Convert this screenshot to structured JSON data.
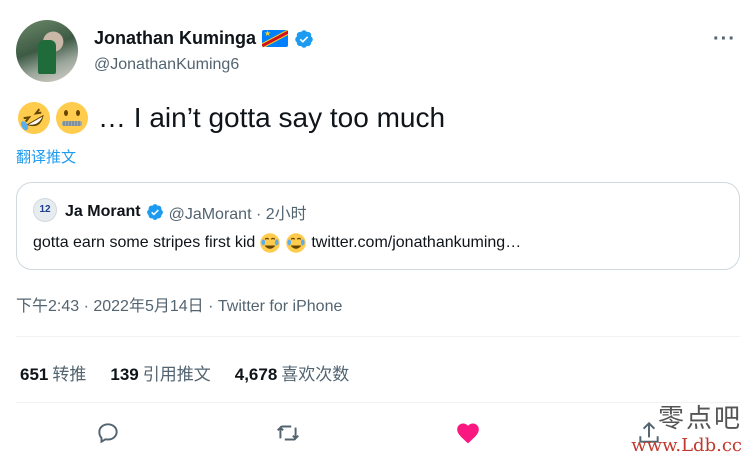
{
  "author": {
    "display_name": "Jonathan Kuminga",
    "handle": "@JonathanKuming6"
  },
  "more_label": "···",
  "tweet": {
    "text": "… I ain’t gotta say too much",
    "emojis": [
      "rolling-on-floor-laughing-emoji",
      "zipper-mouth-face-emoji"
    ],
    "translate_label": "翻译推文"
  },
  "quoted_tweet": {
    "avatar_text": "12",
    "display_name": "Ja Morant",
    "handle_time": "@JaMorant · 2小时",
    "text_prefix": "gotta earn some stripes first kid",
    "text_link": "twitter.com/jonathankuming…",
    "emojis": [
      "face-with-tears-of-joy-emoji",
      "face-with-tears-of-joy-emoji"
    ]
  },
  "meta": "下午2:43 · 2022年5月14日 · Twitter for iPhone",
  "stats": {
    "retweets_count": "651",
    "retweets_label": "转推",
    "quotes_count": "139",
    "quotes_label": "引用推文",
    "likes_count": "4,678",
    "likes_label": "喜欢次数"
  },
  "actions": [
    "reply-icon",
    "retweet-icon",
    "like-icon",
    "share-icon"
  ],
  "colors": {
    "accent": "#1d9bf0",
    "like": "#f91880",
    "secondary_text": "#536471"
  },
  "watermark": {
    "cn": "零点吧",
    "url": "www.Ldb.cc"
  }
}
